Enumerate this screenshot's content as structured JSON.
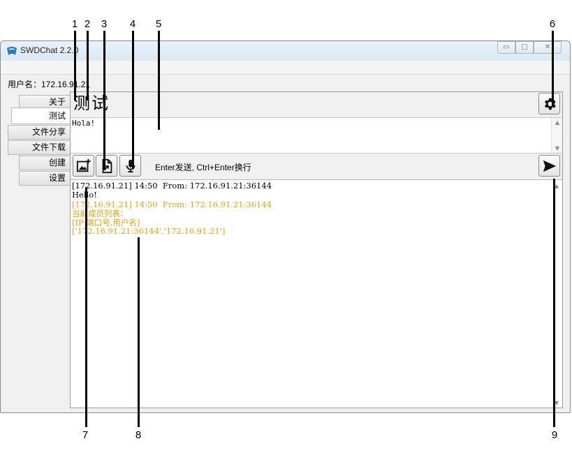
{
  "callouts": {
    "top": [
      "1",
      "2",
      "3",
      "4",
      "5",
      "6"
    ],
    "bottom": [
      "7",
      "8",
      "9"
    ]
  },
  "window": {
    "title": "SWDChat 2.2.0",
    "minimize_glyph": "▭",
    "maximize_glyph": "□",
    "close_glyph": "✕"
  },
  "user": {
    "label": "用户名：172.16.91.21"
  },
  "tabs": [
    {
      "label": "关于"
    },
    {
      "label": "测试"
    },
    {
      "label": "文件分享"
    },
    {
      "label": "文件下载"
    },
    {
      "label": "创建"
    },
    {
      "label": "设置"
    }
  ],
  "chat": {
    "title": "测试",
    "input_value": "Hola!",
    "hint": "Enter发送, Ctrl+Enter换行"
  },
  "icons": {
    "settings": "gear-icon",
    "image": "add-image-icon",
    "file": "file-send-icon",
    "mic": "microphone-icon",
    "send": "send-arrow-icon"
  },
  "messages": [
    {
      "text": "[172.16.91.21] 14:50  From: 172.16.91.21:36144",
      "color": "#000000"
    },
    {
      "text": "Hello!",
      "color": "#000000"
    },
    {
      "text": "[172.16.91.21] 14:50  From: 172.16.91.21:36144",
      "color": "#e8a10c"
    },
    {
      "text": "当前成员列表：",
      "color": "#e8a10c"
    },
    {
      "text": "[IP:端口号,用户名]",
      "color": "#e8a10c"
    },
    {
      "text": "['172.16.91.21:36144','172.16.91.21']",
      "color": "#e8a10c"
    }
  ]
}
